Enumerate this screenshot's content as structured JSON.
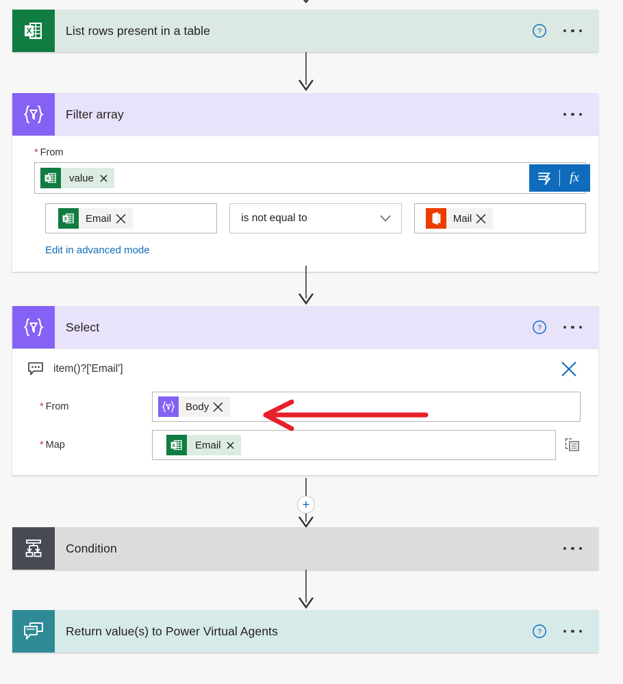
{
  "flow": {
    "cards": [
      {
        "id": "list-rows",
        "title": "List rows present in a table",
        "icon": "excel-icon",
        "help": "?",
        "menu": "more-options"
      },
      {
        "id": "filter-array",
        "title": "Filter array",
        "icon": "data-operation-icon",
        "menu": "more-options"
      },
      {
        "id": "select",
        "title": "Select",
        "icon": "data-operation-icon",
        "help": "?",
        "menu": "more-options"
      },
      {
        "id": "condition",
        "title": "Condition",
        "icon": "condition-icon",
        "menu": "more-options"
      },
      {
        "id": "return-values",
        "title": "Return value(s) to Power Virtual Agents",
        "icon": "power-virtual-agents-icon",
        "help": "?",
        "menu": "more-options"
      }
    ]
  },
  "filter_array": {
    "from_label": "From",
    "required_mark": "*",
    "from_token": {
      "text": "value",
      "icon": "excel-icon",
      "remove": "x"
    },
    "dynamic_content_button": "dynamic-content",
    "fx_button": "fx",
    "left_operand": {
      "text": "Email",
      "icon": "excel-icon",
      "remove": "x"
    },
    "operator": "is not equal to",
    "operator_chevron": "chevron-down-icon",
    "right_operand": {
      "text": "Mail",
      "icon": "office365-outlook-icon",
      "remove": "x"
    },
    "advanced_link": "Edit in advanced mode"
  },
  "select": {
    "comment": "item()?['Email']",
    "comment_icon": "comment-icon",
    "close": "close-icon",
    "from_label": "From",
    "map_label": "Map",
    "required_mark": "*",
    "from_token": {
      "text": "Body",
      "icon": "data-operation-icon",
      "remove": "x"
    },
    "map_token": {
      "text": "Email",
      "icon": "excel-icon",
      "remove": "x"
    },
    "map_mode_toggle": "switch-map-mode-icon"
  },
  "annotation": {
    "arrow": "red-left-arrow",
    "color": "#e8202a"
  },
  "add_step": {
    "label": "+",
    "name": "insert-new-step"
  },
  "colors": {
    "excel_green": "#107c41",
    "excel_card": "#dce8e2",
    "dataop_purple": "#8561f4",
    "dataop_card": "#e9e2fb",
    "control_dark": "#484a53",
    "control_card": "#dcdcdc",
    "pva_teal": "#2e8b96",
    "pva_card": "#d7eaea",
    "accent_blue": "#0f6cbd",
    "required_red": "#d13438"
  }
}
